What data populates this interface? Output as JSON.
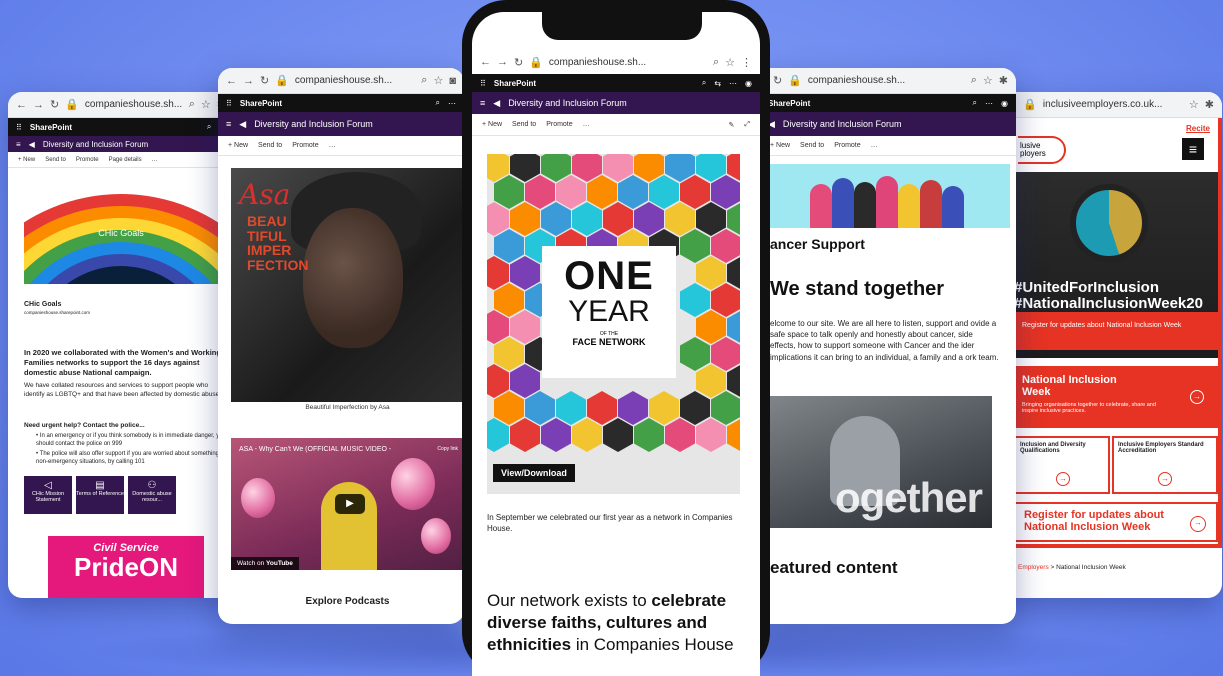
{
  "browser": {
    "url_cs": "companieshouse.sh...",
    "url_ie": "inclusiveemployers.co.uk..."
  },
  "sharepoint": {
    "label": "SharePoint",
    "site_title": "Diversity and Inclusion Forum",
    "cmd_new": "+ New",
    "cmd_send": "Send to",
    "cmd_promote": "Promote",
    "cmd_page_details": "Page details",
    "cmd_more": "…"
  },
  "panel1": {
    "hero_label": "CHic Goals",
    "card_title": "CHic Goals",
    "card_url": "companieshouse.sharepoint.com",
    "para1": "In 2020 we collaborated with the Women's and Working Families networks to support the 16 days against domestic abuse National campaign.",
    "para2": "We have collated resources and services to support people who identify as LGBTQ+ and that have been affected by domestic abuse.",
    "help_title": "Need urgent help? Contact the police...",
    "bullet1": "In an emergency or if you think somebody is in immediate danger, you should contact the police on 999",
    "bullet2": "The police will also offer support if you are worried about something, in non-emergency situations, by calling 101",
    "tiles": [
      "CHic Mission Statement",
      "Terms of Reference",
      "Domestic abuse resour..."
    ],
    "pride_top": "Civil Service",
    "pride_main": "PrideON"
  },
  "panel2": {
    "poster_name": "Asa",
    "poster_title": "BEAU TIFUL IMPER FECTION",
    "caption": "Beautiful Imperfection by Asa",
    "video_title": "ASA - Why Can't We (OFFICIAL MUSIC VIDEO -",
    "copy_link": "Copy link",
    "watch_on": "Watch on",
    "youtube": "YouTube",
    "explore": "Explore Podcasts"
  },
  "panel3": {
    "one": "ONE",
    "year": "YEAR",
    "of_the": "OF THE",
    "face": "FACE NETWORK",
    "view_download": "View/Download",
    "para": "In September we celebrated our first year as a network in Companies House.",
    "heading_pre": "Our network exists to ",
    "heading_bold": "celebrate diverse faiths, cultures and ethnicities",
    "heading_post": " in Companies House"
  },
  "panel4": {
    "section_title": "ancer Support",
    "headline": "We stand together",
    "body": "elcome to our site. We are all here to listen, support and ovide a safe space to talk openly and honestly about cancer, side effects, how to support someone with Cancer and the ider implications it can bring to an individual, a family and a ork team.",
    "photo_word": "ogether",
    "featured": "eatured content"
  },
  "panel5": {
    "recite": "Recite",
    "logo": "lusive ployers",
    "badge_text": "United for Inclusion",
    "hashtag1": "#UnitedForInclusion",
    "hashtag2": "#NationalInclusionWeek20",
    "register_small": "Register for updates about National Inclusion Week",
    "niw_title": "National Inclusion Week",
    "niw_sub": "Bringing organisations together to celebrate, share and inspire inclusive practices.",
    "card1": "Inclusion and Diversity Qualifications",
    "card2": "Inclusive Employers Standard Accreditation",
    "register_big": "Register for updates about National Inclusion Week",
    "crumb_link": "Employers",
    "crumb_rest": " > National Inclusion Week"
  },
  "colors": {
    "sp_purple": "#33164f",
    "ie_red": "#e63323",
    "pride_pink": "#e5187c",
    "background": "#6f8cf0"
  }
}
